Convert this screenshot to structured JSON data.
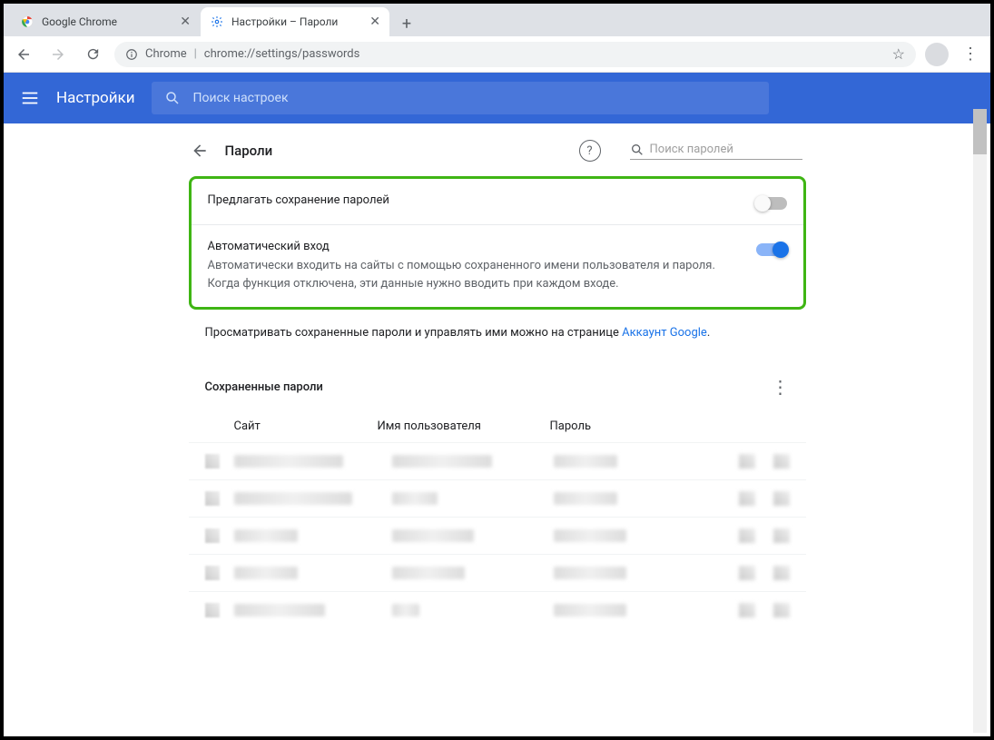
{
  "window": {
    "tabs": [
      {
        "label": "Google Chrome",
        "active": false
      },
      {
        "label": "Настройки – Пароли",
        "active": true
      }
    ]
  },
  "omnibox": {
    "site": "Chrome",
    "url": "chrome://settings/passwords"
  },
  "header": {
    "title": "Настройки",
    "search_placeholder": "Поиск настроек"
  },
  "page": {
    "back_title": "Пароли",
    "search_placeholder": "Поиск паролей",
    "toggle1_label": "Предлагать сохранение паролей",
    "toggle2_label": "Автоматический вход",
    "toggle2_sub": "Автоматически входить на сайты с помощью сохраненного имени пользователя и пароля. Когда функция отключена, эти данные нужно вводить при каждом входе.",
    "info_prefix": "Просматривать сохраненные пароли и управлять ими можно на странице ",
    "info_link": "Аккаунт Google",
    "saved_label": "Сохраненные пароли",
    "col_site": "Сайт",
    "col_user": "Имя пользователя",
    "col_pass": "Пароль"
  }
}
